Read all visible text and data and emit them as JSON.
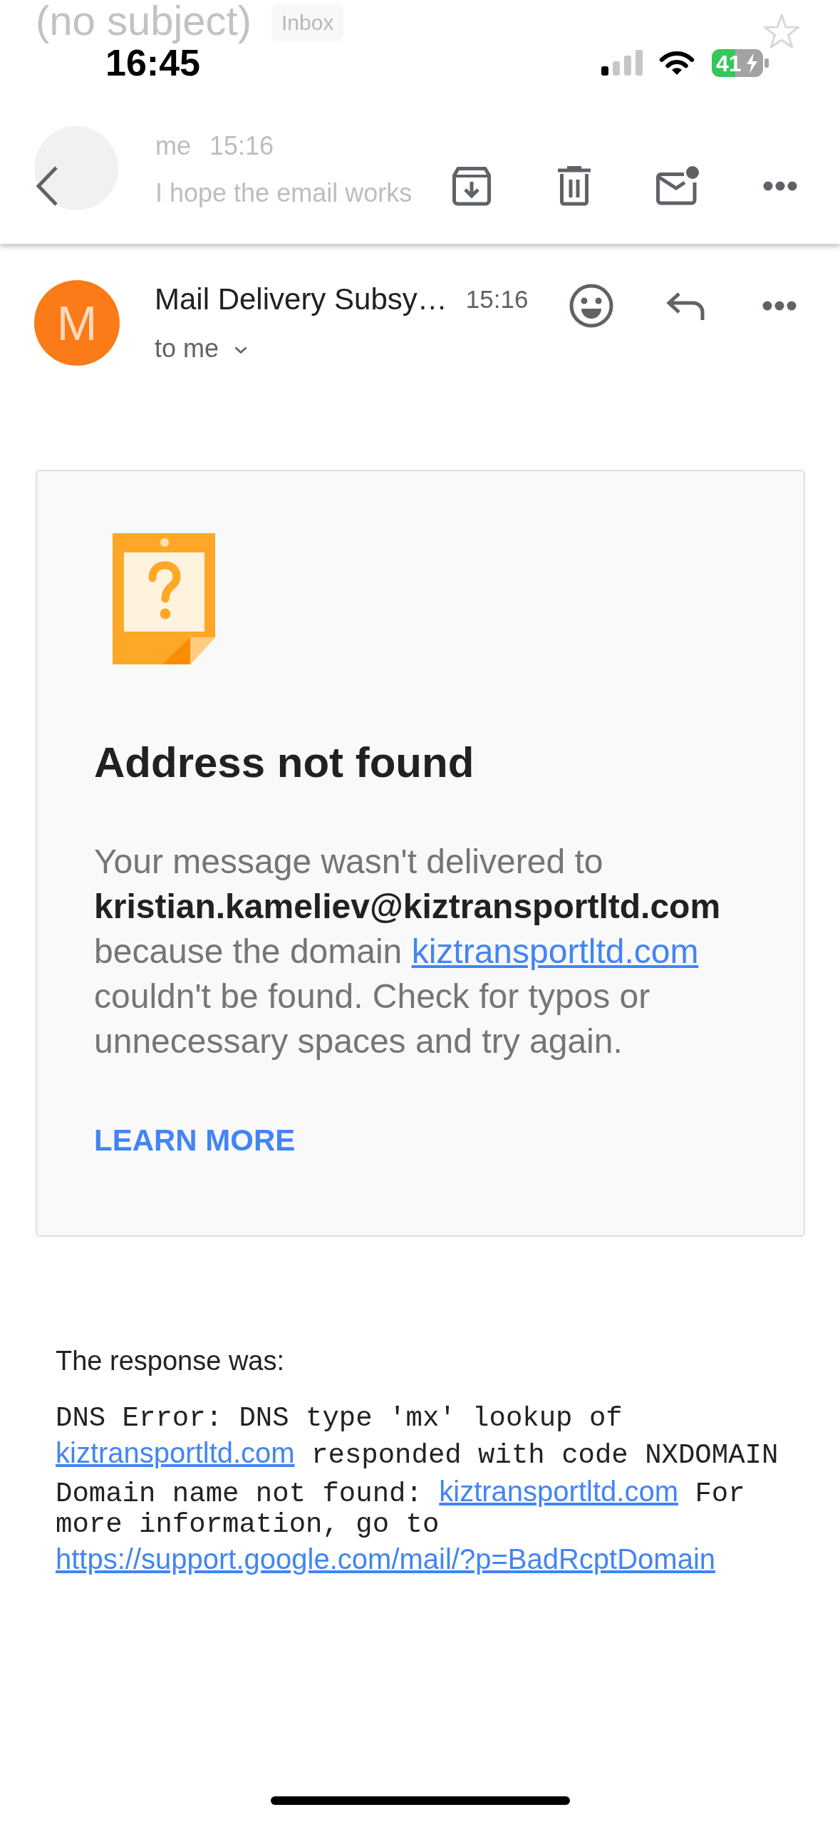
{
  "background_thread": {
    "subject": "(no subject)",
    "label": "Inbox",
    "starred": false,
    "sender": "me",
    "time": "15:16",
    "snippet": "I hope the email works"
  },
  "status_bar": {
    "time": "16:45",
    "battery": "41",
    "charging": true
  },
  "message": {
    "avatar_letter": "M",
    "sender": "Mail Delivery Subsy…",
    "time": "15:16",
    "recipient": "to me"
  },
  "bounce_card": {
    "title": "Address not found",
    "message": [
      {
        "kind": "text",
        "text": "Your message wasn't delivered to"
      },
      {
        "kind": "bold",
        "text": "kristian.kameliev@kiztransportltd.com"
      },
      {
        "kind": "text",
        "text": "because the domain"
      },
      {
        "kind": "link",
        "text": "kiztransportltd.com"
      },
      {
        "kind": "text",
        "text": "couldn't be found. Check for typos or unnecessary spaces and try again."
      }
    ],
    "action": "LEARN MORE"
  },
  "response": {
    "label": "The response was:",
    "details": [
      {
        "kind": "text",
        "text": "DNS Error: DNS type 'mx' lookup of"
      },
      {
        "kind": "link",
        "text": "kiztransportltd.com"
      },
      {
        "kind": "text",
        "text": "responded with code NXDOMAIN Domain name not found:"
      },
      {
        "kind": "link",
        "text": "kiztransportltd.com"
      },
      {
        "kind": "text",
        "text": "For more information, go to"
      },
      {
        "kind": "link",
        "text": "https://support.google.com/mail/?p=BadRcptDomain"
      }
    ]
  }
}
